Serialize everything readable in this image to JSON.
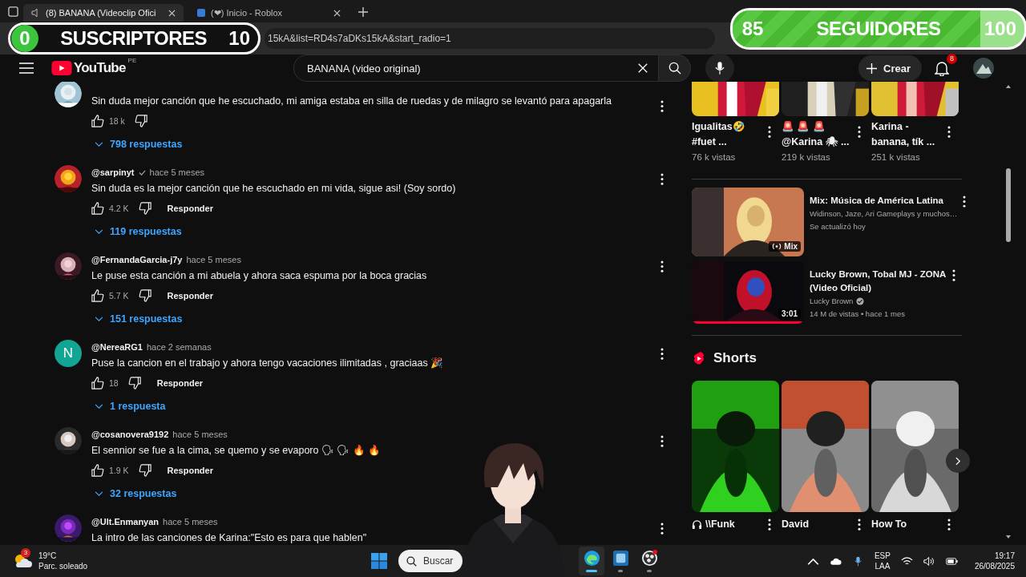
{
  "browser": {
    "tabs": [
      {
        "title": "(8) BANANA (Videoclip Ofici",
        "selected": true
      },
      {
        "title": "(❤) Inicio - Roblox",
        "selected": false
      }
    ],
    "url": "15kA&list=RD4s7aDKs15kA&start_radio=1"
  },
  "overlays": [
    {
      "kind": "left",
      "start": "0",
      "label": "SUSCRIPTORES",
      "goal": "10",
      "level": 0
    },
    {
      "kind": "right",
      "start": "85",
      "label": "SEGUIDORES",
      "goal": "100",
      "level": 0.85
    }
  ],
  "header": {
    "logo": "YouTube",
    "region": "PE",
    "search": "BANANA (video original)",
    "create": "Crear",
    "notifications": "8"
  },
  "comments": [
    {
      "text": "Sin duda mejor canción que he escuchado, mi amiga estaba en silla de ruedas y de milagro se levantó para apagarla",
      "likes": "18 k",
      "replies": "798 respuestas"
    },
    {
      "author": "@sarpinyt",
      "time": "hace 5 meses",
      "verified": true,
      "text": "Sin duda es la mejor canción que he escuchado en mi vida, sigue asi! (Soy sordo)",
      "likes": "4.2 K",
      "reply": "Responder",
      "replies": "119 respuestas"
    },
    {
      "author": "@FernandaGarcia-j7y",
      "time": "hace 5 meses",
      "text": "Le puse esta canción a mi abuela y ahora saca espuma por la boca gracias",
      "likes": "5.7 K",
      "reply": "Responder",
      "replies": "151 respuestas"
    },
    {
      "author": "@NereaRG1",
      "time": "hace 2 semanas",
      "avatar": {
        "kind": "letter",
        "letter": "N",
        "color": "#12a594"
      },
      "text": "Puse la cancion en el trabajo y ahora tengo vacaciones ilimitadas , graciaas 🎉",
      "likes": "18",
      "reply": "Responder",
      "replies": "1 respuesta"
    },
    {
      "author": "@cosanovera9192",
      "time": "hace 5 meses",
      "text": "El sennior se fue a la cima, se quemo y se evaporo 🗣 🗣 🔥 🔥",
      "likes": "1.9 K",
      "reply": "Responder",
      "replies": "32 respuestas"
    },
    {
      "author": "@Ult.Enmanyan",
      "time": "hace 5 meses",
      "text": "La intro de las canciones de Karina:\"Esto es para que hablen\""
    }
  ],
  "related": {
    "shorts_row": [
      {
        "title": "Igualitas🤣\n#fuet ...",
        "views": "76 k vistas"
      },
      {
        "title": "🚨 🚨 🚨\n@Karina 🕷 ...",
        "views": "219 k vistas"
      },
      {
        "title": "Karina -\nbanana, tík ...",
        "views": "251 k vistas"
      }
    ],
    "videos": [
      {
        "kind": "mix",
        "title": "Mix: Música de América Latina",
        "channel": "Widinson, Jaze, Ari Gameplays y muchos…",
        "meta": "Se actualizó hoy",
        "badge": "Mix"
      },
      {
        "kind": "video",
        "title": "Lucky Brown, Tobal MJ - ZONA\n(Video Oficial)",
        "channel": "Lucky Brown",
        "verified": true,
        "meta": "14 M de vistas • hace 1 mes",
        "badge": "3:01",
        "level": 1
      }
    ]
  },
  "shorts": {
    "heading": "Shorts",
    "items": [
      {
        "title": "\\\\Funk",
        "audio": true
      },
      {
        "title": "David"
      },
      {
        "title": "How To"
      }
    ]
  },
  "taskbar": {
    "temp": "19°C",
    "weather": "Parc. soleado",
    "weather_badge": "3",
    "search": "Buscar",
    "apps": [
      {
        "kind": "edge",
        "active": true
      },
      {
        "kind": "vscode",
        "active": false
      },
      {
        "kind": "obs",
        "active": false
      }
    ],
    "lang": "ESP",
    "layout": "LAA",
    "time": "19:17",
    "date": "26/08/2025"
  }
}
